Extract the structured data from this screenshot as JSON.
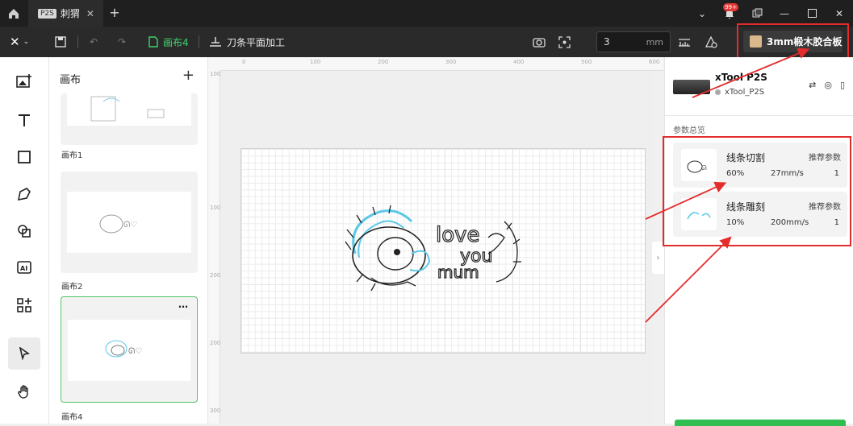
{
  "tabs": [
    {
      "badge": "P2S",
      "label": "刺猬"
    }
  ],
  "notification_count": "99+",
  "toolbar": {
    "canvas_name": "画布4",
    "process_name": "刀条平面加工",
    "thickness_value": "3",
    "thickness_unit": "mm",
    "material_label": "3mm椴木胶合板"
  },
  "canvas_panel": {
    "title": "画布",
    "canvases": [
      {
        "label": "画布1"
      },
      {
        "label": "画布2"
      },
      {
        "label": "画布4",
        "selected": true
      }
    ],
    "more_label": "…"
  },
  "rulers": {
    "top": [
      "0",
      "100",
      "200",
      "300",
      "400",
      "500",
      "600"
    ],
    "left": [
      "100",
      "100",
      "200",
      "200",
      "300"
    ]
  },
  "device": {
    "name": "xTool P2S",
    "sub": "xTool_P2S"
  },
  "params": {
    "title": "参数总览",
    "cards": [
      {
        "name": "线条切割",
        "tag": "推荐参数",
        "power": "60%",
        "speed": "27mm/s",
        "passes": "1"
      },
      {
        "name": "线条雕刻",
        "tag": "推荐参数",
        "power": "10%",
        "speed": "200mm/s",
        "passes": "1"
      }
    ]
  },
  "design_text": [
    "love",
    "you",
    "mum"
  ],
  "colors": {
    "accent": "#3ed46a",
    "highlight": "#e42c2c",
    "wood": "#d9b98c",
    "engrave": "#5bc8e8"
  }
}
